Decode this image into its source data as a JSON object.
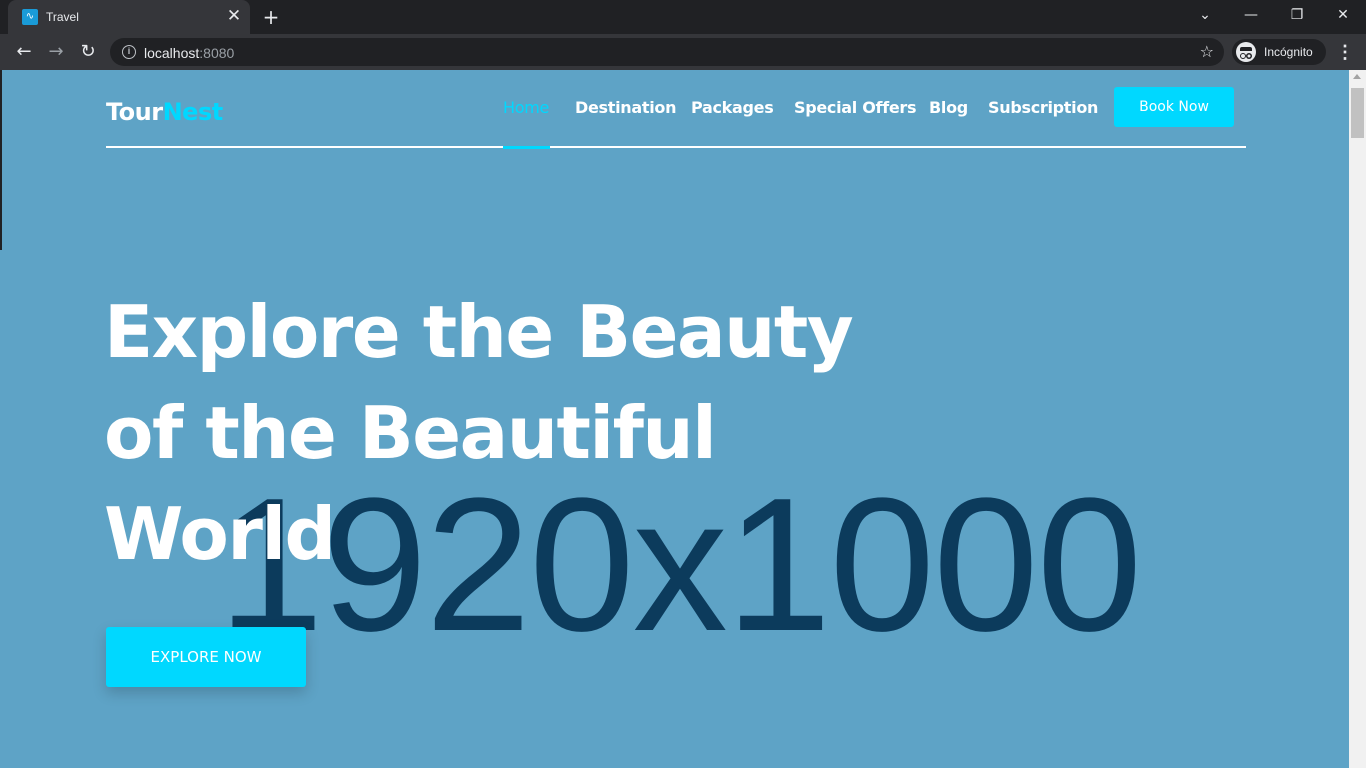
{
  "browser": {
    "tab_title": "Travel",
    "tab_close": "✕",
    "new_tab": "+",
    "url_host": "localhost",
    "url_port": ":8080",
    "profile_label": "Incógnito",
    "window_controls": {
      "dropdown": "⌄",
      "minimize": "—",
      "restore": "❐",
      "close": "✕"
    },
    "nav": {
      "back": "←",
      "forward": "→",
      "reload": "↻",
      "info": "i",
      "star": "☆",
      "menu": "⋮"
    }
  },
  "site": {
    "logo_main": "Tour",
    "logo_accent": "Nest",
    "nav_items": [
      "Home",
      "Destination",
      "Packages",
      "Special Offers",
      "Blog",
      "Subscription"
    ],
    "active_nav": "Home",
    "book_button": "Book Now",
    "hero_lines": [
      "Explore the Beauty",
      "of the Beautiful",
      "World"
    ],
    "explore_button": "EXPLORE NOW",
    "background_placeholder": "1920x1000"
  },
  "colors": {
    "accent": "#00d8ff",
    "hero_bg": "#5ea3c6",
    "placeholder_text": "#0c3b5c"
  }
}
